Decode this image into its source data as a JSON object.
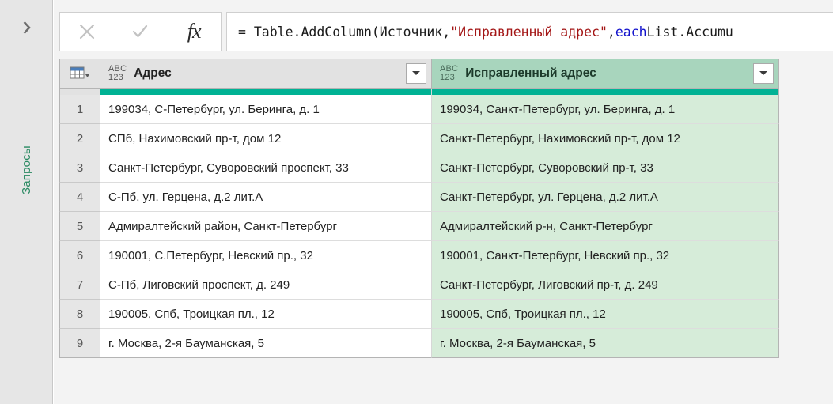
{
  "sidebar": {
    "expand_icon": "chevron-right-icon",
    "label": "Запросы"
  },
  "formula_bar": {
    "cancel_icon": "close-icon",
    "accept_icon": "checkmark-icon",
    "fx_label": "fx",
    "formula_parts": {
      "p1": "= Table.AddColumn(Источник, ",
      "p2": "\"Исправленный адрес\"",
      "p3": ", ",
      "p4": "each",
      "p5": " List.Accumu"
    },
    "formula_full": "= Table.AddColumn(Источник, \"Исправленный адрес\", each List.Accumu"
  },
  "grid": {
    "corner_icon": "table-select-icon",
    "columns": [
      {
        "name": "Адрес",
        "type_icon": "abc123-type-icon",
        "type_top": "ABC",
        "type_bottom": "123",
        "filter_icon": "filter-dropdown-icon"
      },
      {
        "name": "Исправленный адрес",
        "type_icon": "abc123-type-icon",
        "type_top": "ABC",
        "type_bottom": "123",
        "filter_icon": "filter-dropdown-icon"
      }
    ],
    "accent_color": "#00b294",
    "rows": [
      {
        "n": "1",
        "c1": "199034, С-Петербург, ул. Беринга, д. 1",
        "c2": "199034, Санкт-Петербург, ул. Беринга, д. 1"
      },
      {
        "n": "2",
        "c1": "СПб, Нахимовский пр-т, дом 12",
        "c2": "Санкт-Петербург, Нахимовский пр-т, дом 12"
      },
      {
        "n": "3",
        "c1": "Санкт-Петербург, Суворовский проспект, 33",
        "c2": "Санкт-Петербург, Суворовский пр-т, 33"
      },
      {
        "n": "4",
        "c1": "С-Пб, ул. Герцена, д.2 лит.А",
        "c2": "Санкт-Петербург, ул. Герцена, д.2 лит.А"
      },
      {
        "n": "5",
        "c1": "Адмиралтейский район, Санкт-Петербург",
        "c2": "Адмиралтейский р-н, Санкт-Петербург"
      },
      {
        "n": "6",
        "c1": "190001, С.Петербург, Невский пр., 32",
        "c2": "190001, Санкт-Петербург, Невский пр., 32"
      },
      {
        "n": "7",
        "c1": "С-Пб, Лиговский проспект, д. 249",
        "c2": "Санкт-Петербург, Лиговский пр-т, д. 249"
      },
      {
        "n": "8",
        "c1": "190005, Спб, Троицкая пл., 12",
        "c2": "190005, Спб, Троицкая пл., 12"
      },
      {
        "n": "9",
        "c1": "г. Москва, 2-я Бауманская, 5",
        "c2": "г. Москва, 2-я Бауманская, 5"
      }
    ]
  }
}
